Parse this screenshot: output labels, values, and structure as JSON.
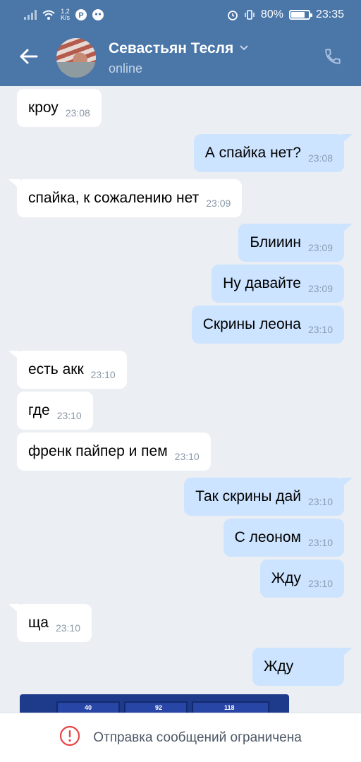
{
  "status_bar": {
    "net_speed_value": "1,2",
    "net_speed_unit": "K/s",
    "battery": "80%",
    "time": "23:35",
    "battery_level": 0.8
  },
  "header": {
    "contact_name": "Севастьян Тесля",
    "status": "online",
    "icons": [
      "back-arrow-icon",
      "chevron-down-icon",
      "phone-icon"
    ]
  },
  "messages": [
    {
      "dir": "in",
      "text": "кроу",
      "time": "23:08"
    },
    {
      "dir": "out",
      "text": "А спайка нет?",
      "time": "23:08"
    },
    {
      "dir": "in",
      "text": "спайка, к сожалению нет",
      "time": "23:09"
    },
    {
      "dir": "out",
      "text": "Блииин",
      "time": "23:09"
    },
    {
      "dir": "out",
      "text": "Ну давайте",
      "time": "23:09"
    },
    {
      "dir": "out",
      "text": "Скрины леона",
      "time": "23:10"
    },
    {
      "dir": "in",
      "text": "есть акк",
      "time": "23:10"
    },
    {
      "dir": "in",
      "text": "где",
      "time": "23:10"
    },
    {
      "dir": "in",
      "text": "френк пайпер и пем",
      "time": "23:10"
    },
    {
      "dir": "out",
      "text": "Так скрины дай",
      "time": "23:10"
    },
    {
      "dir": "out",
      "text": "С леоном",
      "time": "23:10"
    },
    {
      "dir": "out",
      "text": "Жду",
      "time": "23:10"
    },
    {
      "dir": "in",
      "text": "ща",
      "time": "23:10"
    },
    {
      "dir": "out",
      "text": "Жду",
      "time": ""
    }
  ],
  "photo_preview": {
    "values": [
      "40",
      "92",
      "118"
    ]
  },
  "bottom_bar": {
    "restriction_text": "Отправка сообщений ограничена"
  },
  "colors": {
    "header": "#4a76a8",
    "background": "#ebeef2",
    "bubble_in": "#ffffff",
    "bubble_out": "#cce4ff",
    "warning": "#e64646"
  }
}
